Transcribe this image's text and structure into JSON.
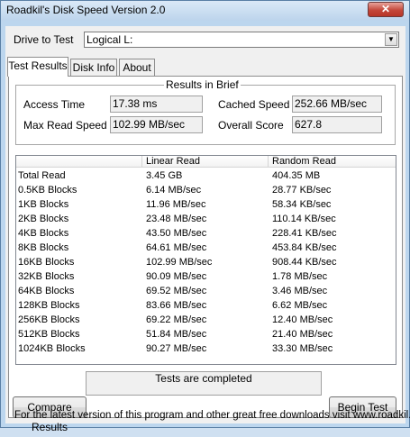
{
  "window": {
    "title": "Roadkil's Disk Speed Version 2.0",
    "close_glyph": "✕"
  },
  "drive": {
    "label": "Drive to Test",
    "selected": "Logical L:"
  },
  "tabs": [
    "Test Results",
    "Disk Info",
    "About"
  ],
  "brief": {
    "title": "Results in Brief",
    "access_time_label": "Access Time",
    "access_time": "17.38 ms",
    "max_read_label": "Max Read Speed",
    "max_read": "102.99 MB/sec",
    "cached_label": "Cached Speed",
    "cached": "252.66 MB/sec",
    "overall_label": "Overall Score",
    "overall": "627.8"
  },
  "table": {
    "columns": [
      "",
      "Linear Read",
      "Random Read"
    ],
    "rows": [
      [
        "Total Read",
        "3.45 GB",
        "404.35 MB"
      ],
      [
        "0.5KB Blocks",
        "6.14 MB/sec",
        "28.77 KB/sec"
      ],
      [
        "1KB Blocks",
        "11.96 MB/sec",
        "58.34 KB/sec"
      ],
      [
        "2KB Blocks",
        "23.48 MB/sec",
        "110.14 KB/sec"
      ],
      [
        "4KB Blocks",
        "43.50 MB/sec",
        "228.41 KB/sec"
      ],
      [
        "8KB Blocks",
        "64.61 MB/sec",
        "453.84 KB/sec"
      ],
      [
        "16KB Blocks",
        "102.99 MB/sec",
        "908.44 KB/sec"
      ],
      [
        "32KB Blocks",
        "90.09 MB/sec",
        "1.78 MB/sec"
      ],
      [
        "64KB Blocks",
        "69.52 MB/sec",
        "3.46 MB/sec"
      ],
      [
        "128KB Blocks",
        "83.66 MB/sec",
        "6.62 MB/sec"
      ],
      [
        "256KB Blocks",
        "69.22 MB/sec",
        "12.40 MB/sec"
      ],
      [
        "512KB Blocks",
        "51.84 MB/sec",
        "21.40 MB/sec"
      ],
      [
        "1024KB Blocks",
        "90.27 MB/sec",
        "33.30 MB/sec"
      ]
    ]
  },
  "buttons": {
    "compare": "Compare Results",
    "begin": "Begin Test"
  },
  "status_text": "Tests are completed",
  "footer": "For the latest version of this program and other great free downloads visit www.roadkil.net"
}
